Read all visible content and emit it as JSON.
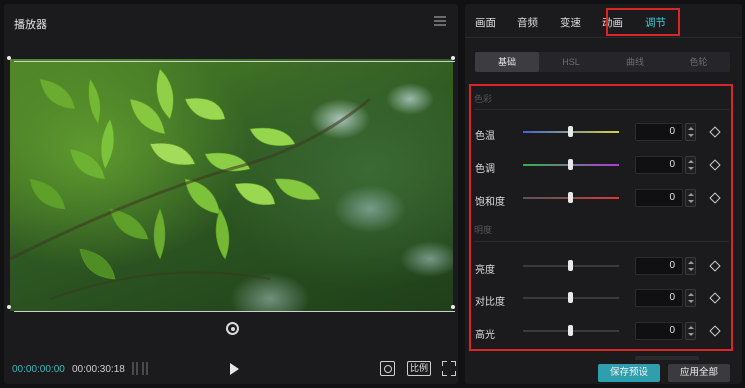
{
  "player": {
    "title": "播放器",
    "current_time": "00:00:00:00",
    "total_time": "00:00:30:18",
    "ratio_label": "比例",
    "icons": [
      "menu-icon",
      "rotate-icon",
      "play-icon",
      "focus-icon",
      "fullscreen-icon"
    ]
  },
  "panel": {
    "tabs": [
      {
        "label": "画面"
      },
      {
        "label": "音频"
      },
      {
        "label": "变速"
      },
      {
        "label": "动画"
      },
      {
        "label": "调节",
        "active": true
      }
    ],
    "subtabs": [
      {
        "label": "基础",
        "active": true
      },
      {
        "label": "HSL"
      },
      {
        "label": "曲线"
      },
      {
        "label": "色轮"
      }
    ],
    "sections": [
      {
        "label": "色彩",
        "rows": [
          {
            "label": "色温",
            "value": "0",
            "track_colors": [
              "#3a67d6",
              "#d8d23a"
            ]
          },
          {
            "label": "色调",
            "value": "0",
            "track_colors": [
              "#32b24a",
              "#b23ad8"
            ]
          },
          {
            "label": "饱和度",
            "value": "0",
            "track_colors": [
              "#555555",
              "#d83a3a"
            ]
          }
        ]
      },
      {
        "label": "明度",
        "rows": [
          {
            "label": "亮度",
            "value": "0"
          },
          {
            "label": "对比度",
            "value": "0"
          },
          {
            "label": "高光",
            "value": "0"
          }
        ]
      }
    ],
    "save_preset_label": "保存预设",
    "apply_all_label": "应用全部"
  },
  "colors": {
    "accent": "#3fc7d8",
    "highlight_border": "#d8252a",
    "save_button": "#2f9fae"
  }
}
